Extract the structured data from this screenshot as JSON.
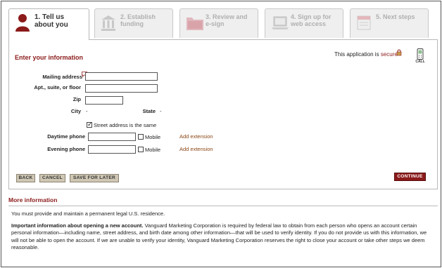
{
  "steps": [
    {
      "number_label": "1. Tell us\nabout you",
      "icon": "person-icon",
      "state": "active"
    },
    {
      "number_label": "2. Establish\nfunding",
      "icon": "bank-icon",
      "state": "inactive"
    },
    {
      "number_label": "3. Review and\ne-sign",
      "icon": "folder-icon",
      "state": "inactive"
    },
    {
      "number_label": "4. Sign up for\nweb access",
      "icon": "laptop-icon",
      "state": "inactive"
    },
    {
      "number_label": "5. Next steps",
      "icon": "calendar-icon",
      "state": "inactive"
    }
  ],
  "form": {
    "title": "Enter your information",
    "secure_prefix": "This application is",
    "secure_word": "secure",
    "call_label": "CALL",
    "mailing_address_label": "Mailing address",
    "apt_label": "Apt., suite, or floor",
    "zip_label": "Zip",
    "city_label": "City",
    "city_value": "-",
    "state_label": "State",
    "state_value": "-",
    "street_same_label": "Street address is the same",
    "street_same_checked": true,
    "daytime_phone_label": "Daytime phone",
    "evening_phone_label": "Evening phone",
    "mobile_label": "Mobile",
    "add_extension_label": "Add extension"
  },
  "buttons": {
    "back": "BACK",
    "cancel": "CANCEL",
    "save_later": "SAVE FOR LATER",
    "continue": "CONTINUE"
  },
  "more_info": {
    "title": "More information",
    "residence_text": "You must provide and maintain a permanent legal U.S. residence.",
    "important_heading": "Important information about opening a new account.",
    "important_text": "Vanguard Marketing Corporation is required by federal law to obtain from each person who opens an account certain personal information—including name, street address, and birth date among other information—that will be used to verify identity. If you do not provide us with this information, we will not be able to open the account. If we are unable to verify your identity, Vanguard Marketing Corporation reserves the right to close your account or take other steps we deem reasonable."
  },
  "colors": {
    "accent": "#8b1a1a",
    "link": "#8b4513",
    "button_bg": "#cfc7b4"
  }
}
